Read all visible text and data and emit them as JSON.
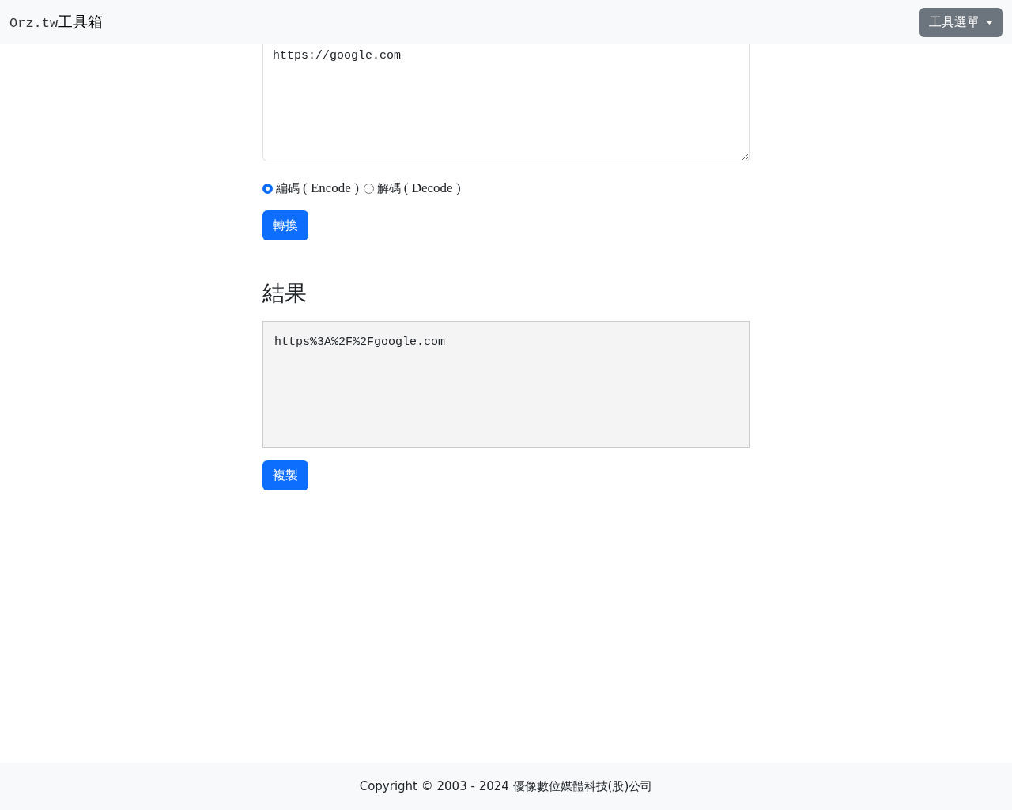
{
  "navbar": {
    "brand_prefix": "Orz.tw",
    "brand_name": "工具箱",
    "menu_button": "工具選單"
  },
  "input": {
    "value": "https://google.com"
  },
  "modes": [
    {
      "label": "編碼",
      "suffix": "( Encode )",
      "selected": true
    },
    {
      "label": "解碼",
      "suffix": "( Decode )",
      "selected": false
    }
  ],
  "convert_button": "轉換",
  "result_heading": "結果",
  "result": {
    "value": "https%3A%2F%2Fgoogle.com"
  },
  "copy_button": "複製",
  "footer": "Copyright © 2003 - 2024 優像數位媒體科技(股)公司"
}
